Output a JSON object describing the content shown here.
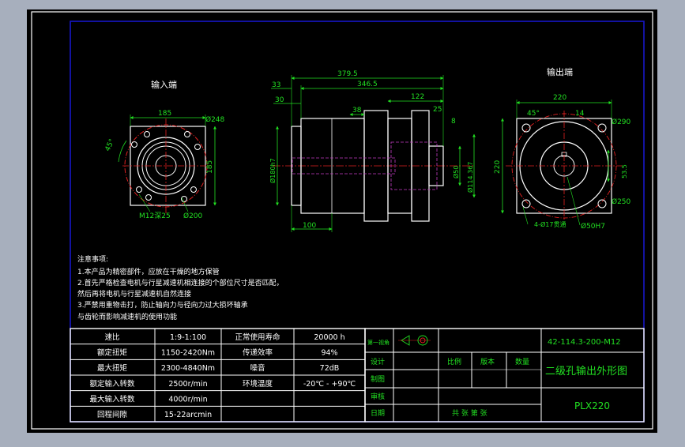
{
  "views": {
    "input_label": "输入端",
    "output_label": "输出端"
  },
  "input_view": {
    "dim_width": "185",
    "dim_height": "185",
    "dim_hole_circle": "Ø248",
    "dim_angle": "45°",
    "dim_bolt": "M12深25",
    "dim_pilot": "Ø200"
  },
  "side_view": {
    "dim_overall": "379.5",
    "dim_body": "346.5",
    "dim_33": "33",
    "dim_30": "30",
    "dim_38": "38",
    "dim_122": "122",
    "dim_25": "25",
    "dim_8": "8",
    "dim_100": "100",
    "dim_motor_pilot": "Ø180h7",
    "dim_shaft": "Ø50",
    "dim_114": "Ø114.367"
  },
  "output_view": {
    "dim_width": "220",
    "dim_height": "220",
    "dim_14": "14",
    "dim_angle": "45°",
    "dim_290": "Ø290",
    "dim_53": "53.5",
    "dim_250": "Ø250",
    "dim_holes": "4-Ø17贯通",
    "dim_50h7": "Ø50H7"
  },
  "notes": {
    "title": "注意事项:",
    "line1": "1.本产品为精密部件，应放在干燥的地方保管",
    "line2": "2.首先严格检查电机与行星减速机相连接的个部位尺寸是否匹配，",
    "line3": "然后再将电机与行星减速机自然连接",
    "line4": "3.严禁用重物击打，防止轴向力与径向力过大损坏轴承",
    "line5": "与齿轮而影响减速机的使用功能"
  },
  "spec_table": [
    {
      "k1": "速比",
      "v1": "1:9-1:100",
      "k2": "正常使用寿命",
      "v2": "20000 h"
    },
    {
      "k1": "额定扭矩",
      "v1": "1150-2420Nm",
      "k2": "传递效率",
      "v2": "94%"
    },
    {
      "k1": "最大扭矩",
      "v1": "2300-4840Nm",
      "k2": "噪音",
      "v2": "72dB"
    },
    {
      "k1": "额定输入转数",
      "v1": "2500r/min",
      "k2": "环境温度",
      "v2": "-20℃ - +90℃"
    },
    {
      "k1": "最大输入转数",
      "v1": "4000r/min",
      "k2": "",
      "v2": ""
    },
    {
      "k1": "回程间隙",
      "v1": "15-22arcmin",
      "k2": "",
      "v2": ""
    }
  ],
  "title_block": {
    "projection": "第一视角",
    "design": "设计",
    "drawing": "制图",
    "date": "日期",
    "review": "审核",
    "date2": "日期",
    "scale": "比例",
    "version": "版本",
    "quantity": "数量",
    "sheets": "共  张  第  张",
    "drawing_no": "42-114.3-200-M12",
    "drawing_name": "二级孔输出外形图",
    "model": "PLX220"
  },
  "colors": {
    "background": "#000000",
    "frame": "#ffffff",
    "border": "#1616c8",
    "dimension": "#22e022",
    "object": "#ffffff",
    "center": "#e02020",
    "hidden": "#c23cc2"
  }
}
